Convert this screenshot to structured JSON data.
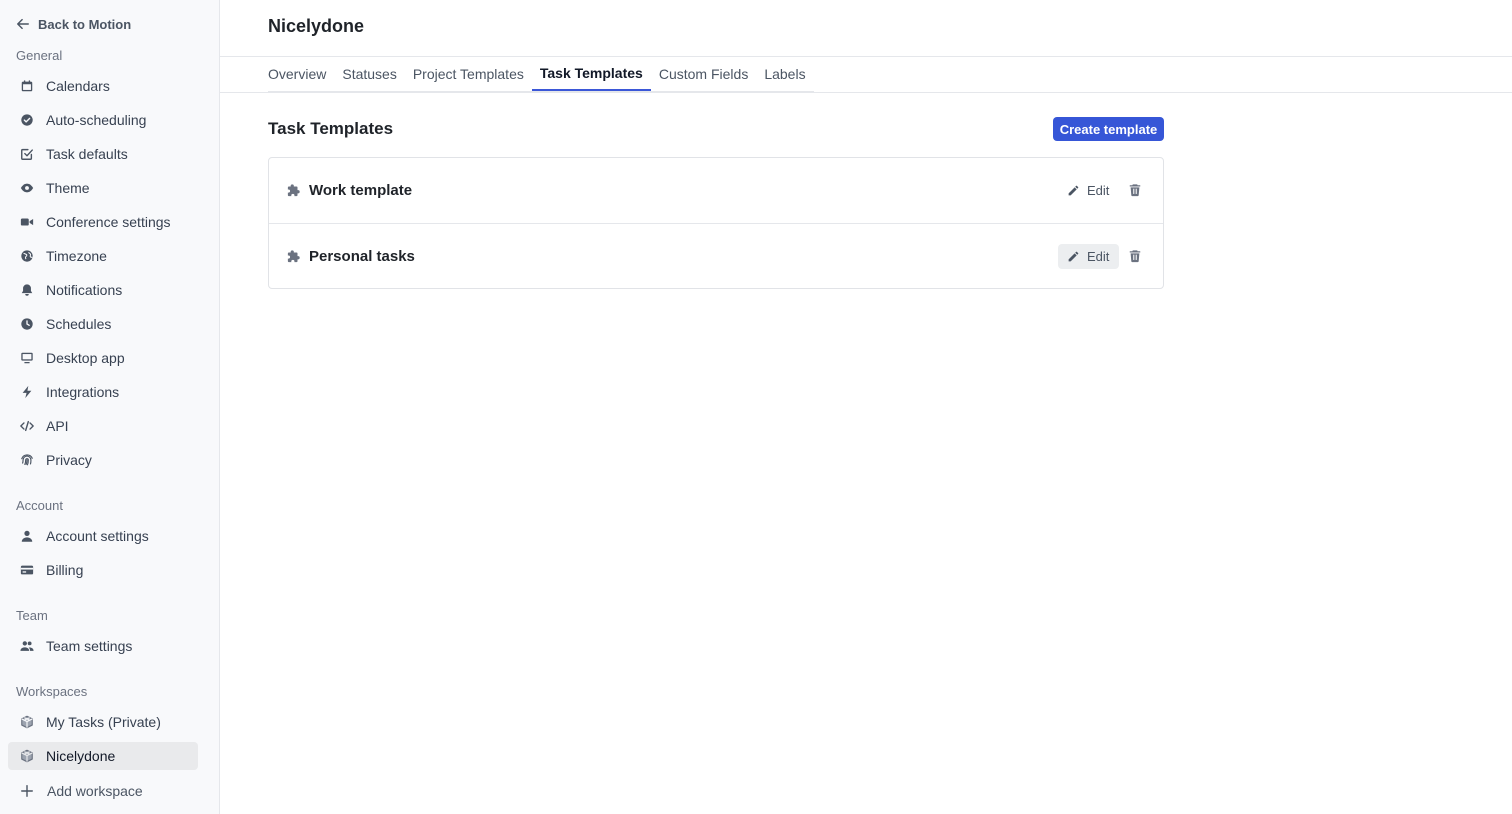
{
  "sidebar": {
    "back_label": "Back to Motion",
    "sections": {
      "general": "General",
      "account": "Account",
      "team": "Team",
      "workspaces": "Workspaces"
    },
    "general_items": [
      {
        "label": "Calendars",
        "icon": "calendar-icon"
      },
      {
        "label": "Auto-scheduling",
        "icon": "check-circle-icon"
      },
      {
        "label": "Task defaults",
        "icon": "checkbox-icon"
      },
      {
        "label": "Theme",
        "icon": "eye-icon"
      },
      {
        "label": "Conference settings",
        "icon": "video-icon"
      },
      {
        "label": "Timezone",
        "icon": "globe-icon"
      },
      {
        "label": "Notifications",
        "icon": "bell-icon"
      },
      {
        "label": "Schedules",
        "icon": "clock-icon"
      },
      {
        "label": "Desktop app",
        "icon": "monitor-icon"
      },
      {
        "label": "Integrations",
        "icon": "lightning-icon"
      },
      {
        "label": "API",
        "icon": "code-icon"
      },
      {
        "label": "Privacy",
        "icon": "fingerprint-icon"
      }
    ],
    "account_items": [
      {
        "label": "Account settings",
        "icon": "user-icon"
      },
      {
        "label": "Billing",
        "icon": "credit-card-icon"
      }
    ],
    "team_items": [
      {
        "label": "Team settings",
        "icon": "users-icon"
      }
    ],
    "workspace_items": [
      {
        "label": "My Tasks (Private)",
        "icon": "cube-icon"
      },
      {
        "label": "Nicelydone",
        "icon": "cube-icon",
        "active": true
      }
    ],
    "add_workspace_label": "Add workspace"
  },
  "main": {
    "title": "Nicelydone",
    "tabs": [
      "Overview",
      "Statuses",
      "Project Templates",
      "Task Templates",
      "Custom Fields",
      "Labels"
    ],
    "active_tab": "Task Templates",
    "section_title": "Task Templates",
    "create_button_label": "Create template",
    "templates": [
      {
        "name": "Work template",
        "edit_label": "Edit"
      },
      {
        "name": "Personal tasks",
        "edit_label": "Edit"
      }
    ]
  },
  "colors": {
    "accent": "#3656d7",
    "sidebar_bg": "#f8f9fb",
    "active_item_bg": "#e9eaec"
  }
}
